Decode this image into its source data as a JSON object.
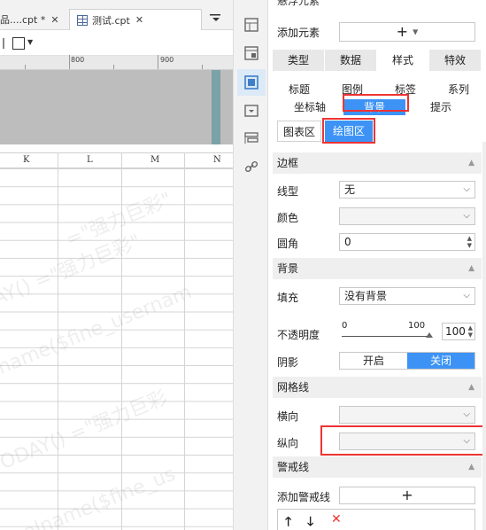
{
  "tabs": [
    {
      "label": "品....cpt *",
      "close": "✕"
    },
    {
      "label": "测试.cpt",
      "close": "✕"
    }
  ],
  "tab_menu_icon": "▼",
  "ruler": [
    "800",
    "900"
  ],
  "columns": [
    "K",
    "L",
    "M",
    "N"
  ],
  "watermark": [
    "=\"强力巨彩\"",
    "DAY() =\"强力巨彩\"",
    "name($fine_usernam",
    "TODAY() =\"强力巨彩",
    "realname($fine_us"
  ],
  "panel": {
    "float_title": "悬浮元素",
    "add_element_label": "添加元素",
    "add_element_button": "+",
    "main_tabs": [
      "类型",
      "数据",
      "样式",
      "特效"
    ],
    "main_active": "样式",
    "sub_tabs_row1": [
      "标题",
      "图例",
      "标签",
      "系列"
    ],
    "sub_tabs_row2": [
      "坐标轴",
      "背景",
      "提示"
    ],
    "sub_active": "背景",
    "mode_tabs": [
      "图表区",
      "绘图区"
    ],
    "mode_active": "绘图区",
    "sections": {
      "border": {
        "title": "边框",
        "line_type_label": "线型",
        "line_type_value": "无",
        "color_label": "颜色",
        "color_value": "",
        "radius_label": "圆角",
        "radius_value": "0"
      },
      "background": {
        "title": "背景",
        "fill_label": "填充",
        "fill_value": "没有背景",
        "opacity_label": "不透明度",
        "slider_min": "0",
        "slider_max": "100",
        "opacity_value": "100",
        "opacity_level": 1.0,
        "shadow_label": "阴影",
        "shadow_on": "开启",
        "shadow_off": "关闭",
        "shadow_active": "关闭"
      },
      "grid": {
        "title": "网格线",
        "horizontal_label": "横向",
        "horizontal_value": "",
        "vertical_label": "纵向",
        "vertical_value": ""
      },
      "warning": {
        "title": "警戒线",
        "add_label": "添加警戒线",
        "add_button": "+",
        "up_icon": "🡑",
        "down_icon": "🡓",
        "delete_icon": "✕"
      }
    }
  },
  "colors": {
    "accent": "#3d93f5",
    "highlight": "#e33333",
    "panel_section": "#efefef"
  }
}
